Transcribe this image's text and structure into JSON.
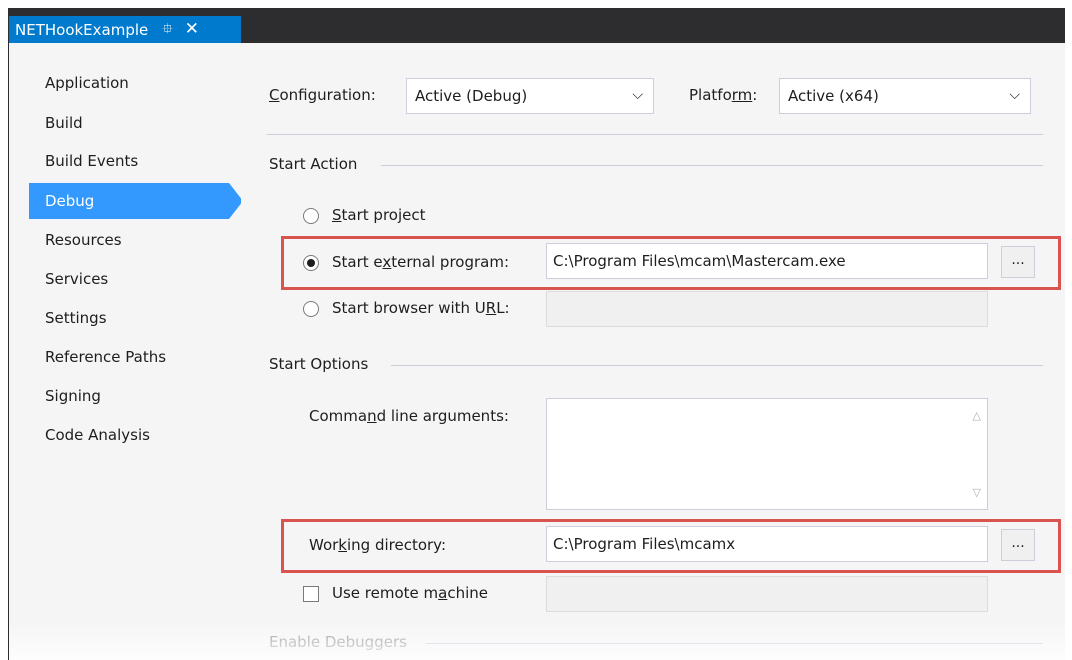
{
  "tab": {
    "title": "NETHookExample",
    "pin_icon": "pin-icon",
    "close_icon": "close-icon"
  },
  "sidebar": {
    "items": [
      {
        "label": "Application"
      },
      {
        "label": "Build"
      },
      {
        "label": "Build Events"
      },
      {
        "label": "Debug",
        "active": true
      },
      {
        "label": "Resources"
      },
      {
        "label": "Services"
      },
      {
        "label": "Settings"
      },
      {
        "label": "Reference Paths"
      },
      {
        "label": "Signing"
      },
      {
        "label": "Code Analysis"
      }
    ]
  },
  "config": {
    "configuration_label_u": "C",
    "configuration_label_rest": "onfiguration:",
    "configuration_value": "Active (Debug)",
    "platform_label_a": "Platfo",
    "platform_label_u": "rm",
    "platform_label_b": ":",
    "platform_value": "Active (x64)"
  },
  "start_action": {
    "section_title": "Start Action",
    "start_project_u": "S",
    "start_project_rest": "tart project",
    "external_a": "Start e",
    "external_u": "x",
    "external_b": "ternal program:",
    "external_value": "C:\\Program Files\\mcam\\Mastercam.exe",
    "browser_a": "Start browser with U",
    "browser_u": "R",
    "browser_b": "L:",
    "browser_value": "",
    "browse_label": "...",
    "selected": "Start external program"
  },
  "start_options": {
    "section_title": "Start Options",
    "cmd_a": "Comma",
    "cmd_u": "n",
    "cmd_b": "d line arguments:",
    "cmd_value": "",
    "workdir_a": "Wor",
    "workdir_u": "k",
    "workdir_b": "ing directory:",
    "workdir_value": "C:\\Program Files\\mcamx",
    "browse_label": "...",
    "remote_a": "Use remote m",
    "remote_u": "a",
    "remote_b": "chine",
    "remote_value": "",
    "remote_checked": false
  },
  "debuggers": {
    "section_title": "Enable Debuggers"
  },
  "colors": {
    "accent": "#007acc",
    "selection": "#3399ff",
    "highlight_box": "#d9534f",
    "titlebar": "#2d2d30"
  }
}
